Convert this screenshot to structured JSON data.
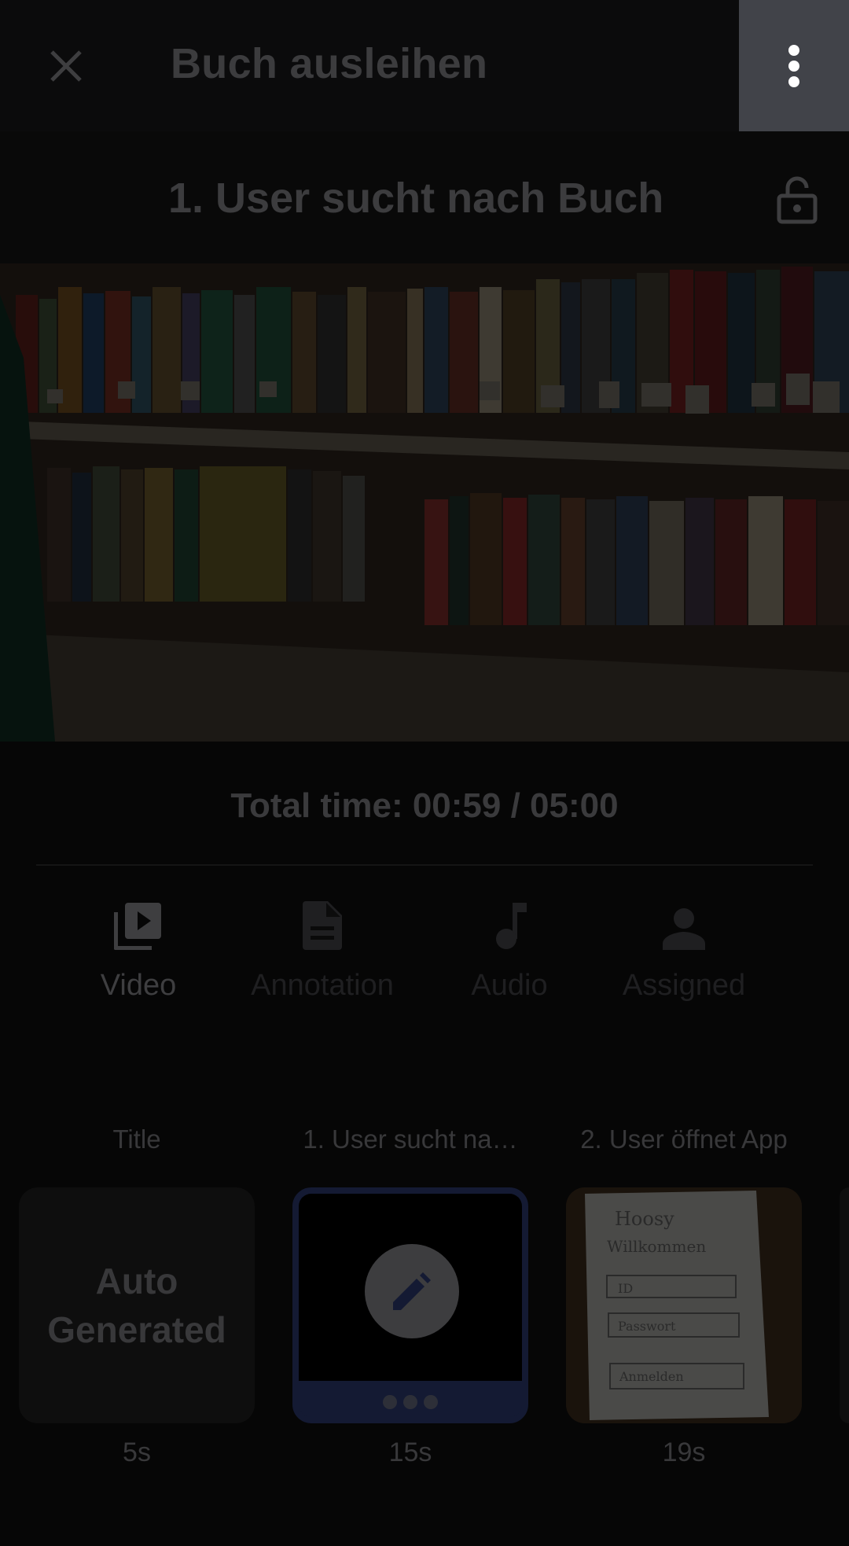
{
  "app_bar": {
    "title": "Buch ausleihen",
    "close_icon": "close-icon",
    "menu_icon": "more-vert-icon"
  },
  "scene": {
    "title": "1. User sucht nach Buch",
    "lock_icon": "lock-open-icon"
  },
  "preview": {
    "description_icon": "video-preview"
  },
  "timer": {
    "label": "Total time: 00:59 / 05:00"
  },
  "tabs": [
    {
      "label": "Video",
      "icon": "video-library-icon",
      "active": true
    },
    {
      "label": "Annotation",
      "icon": "description-icon",
      "active": false
    },
    {
      "label": "Audio",
      "icon": "music-note-icon",
      "active": false
    },
    {
      "label": "Assigned",
      "icon": "person-icon",
      "active": false
    }
  ],
  "scenes": [
    {
      "name": "Title",
      "thumb_line1": "Auto",
      "thumb_line2": "Generated",
      "duration": "5s"
    },
    {
      "name": "1. User sucht na…",
      "duration": "15s",
      "selected": true,
      "icon": "edit-icon"
    },
    {
      "name": "2. User öffnet App",
      "duration": "19s",
      "paper_lines": [
        "Hoosy",
        "Willkommen",
        "ID",
        "Passwort",
        "Anmelden"
      ]
    }
  ],
  "colors": {
    "overlay_dim": "#060606",
    "menu_highlight": "#414349",
    "selected_border": "#141a33"
  }
}
